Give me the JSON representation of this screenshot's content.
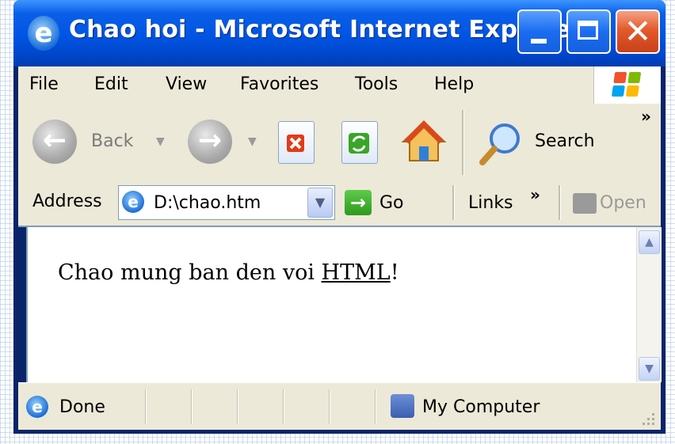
{
  "window": {
    "title": "Chao hoi - Microsoft Internet Explorer",
    "accent": "#0054e3",
    "close_color": "#e35a2c"
  },
  "menu": [
    "File",
    "Edit",
    "View",
    "Favorites",
    "Tools",
    "Help"
  ],
  "toolbar": {
    "back_label": "Back",
    "search_label": "Search",
    "chevron": "»"
  },
  "address": {
    "label": "Address",
    "value": "D:\\chao.htm",
    "go_label": "Go",
    "links_label": "Links",
    "links_chevron": "»",
    "open_label": "Open"
  },
  "page": {
    "text_before": "Chao mung ban den voi ",
    "link_text": "HTML",
    "text_after": "!"
  },
  "status": {
    "text": "Done",
    "zone": "My Computer"
  }
}
